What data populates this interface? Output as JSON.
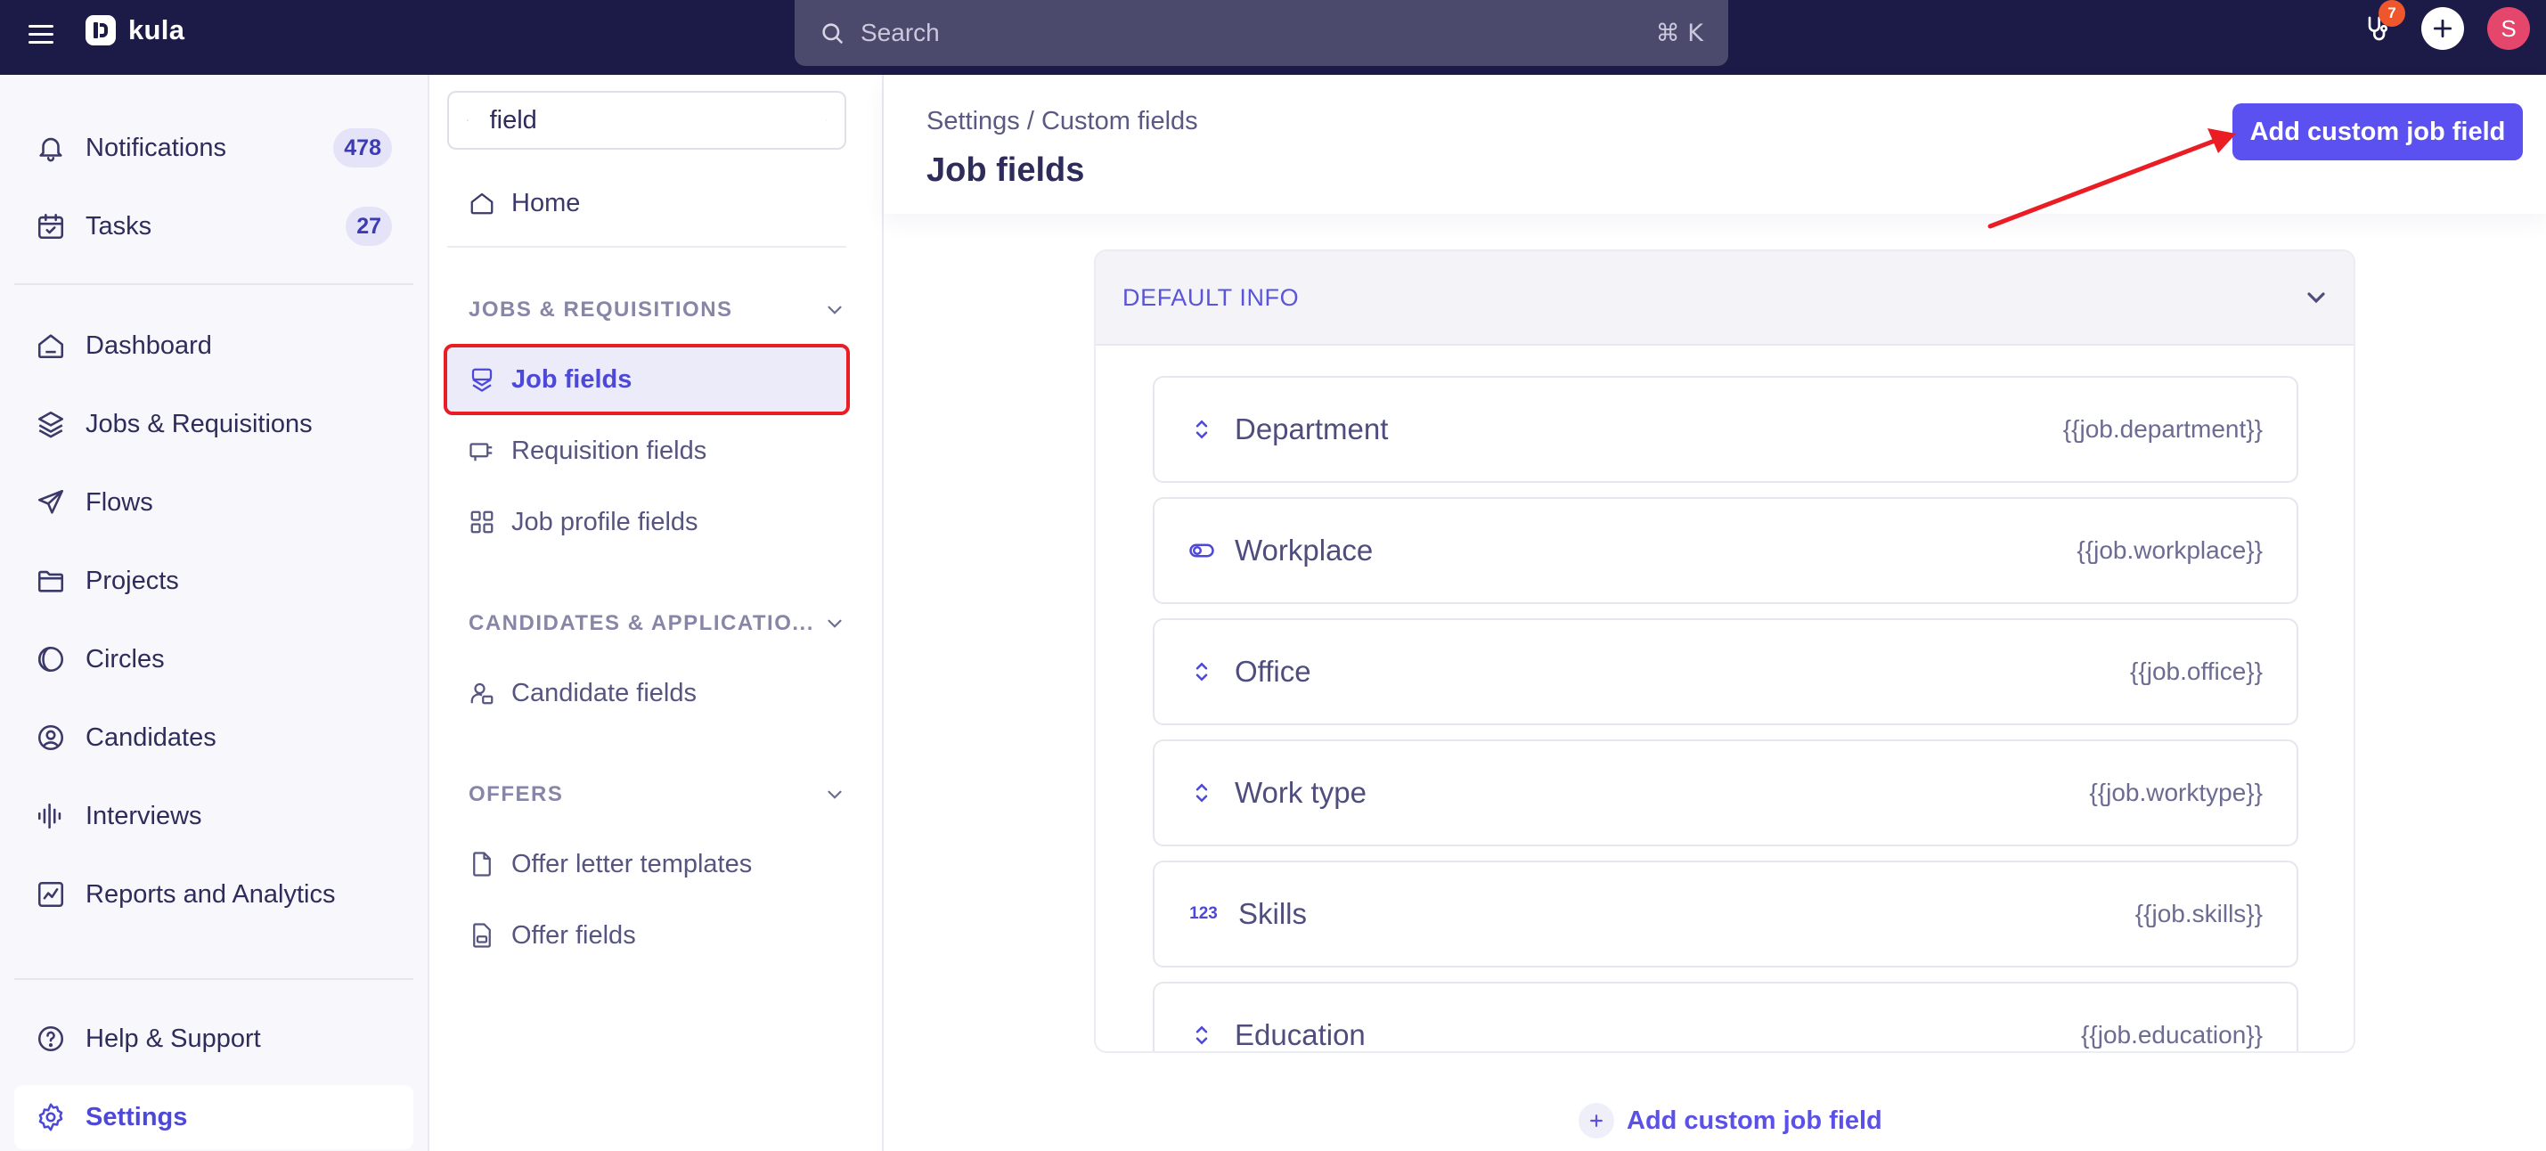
{
  "app": {
    "name": "kula"
  },
  "topbar": {
    "search_placeholder": "Search",
    "shortcut": "⌘ K",
    "notification_badge": "7",
    "avatar_initial": "S"
  },
  "sidebar": {
    "notifications": {
      "label": "Notifications",
      "count": "478"
    },
    "tasks": {
      "label": "Tasks",
      "count": "27"
    },
    "items": [
      {
        "label": "Dashboard",
        "icon": "home-icon"
      },
      {
        "label": "Jobs & Requisitions",
        "icon": "layers-icon"
      },
      {
        "label": "Flows",
        "icon": "send-icon"
      },
      {
        "label": "Projects",
        "icon": "folder-icon"
      },
      {
        "label": "Circles",
        "icon": "circles-icon"
      },
      {
        "label": "Candidates",
        "icon": "user-circle-icon"
      },
      {
        "label": "Interviews",
        "icon": "waveform-icon"
      },
      {
        "label": "Reports and Analytics",
        "icon": "chart-icon"
      }
    ],
    "help": "Help & Support",
    "settings": "Settings"
  },
  "subnav": {
    "search_value": "field",
    "home": "Home",
    "sections": [
      {
        "title": "JOBS & REQUISITIONS",
        "items": [
          "Job fields",
          "Requisition fields",
          "Job profile fields"
        ]
      },
      {
        "title": "CANDIDATES & APPLICATIO...",
        "items": [
          "Candidate fields"
        ]
      },
      {
        "title": "OFFERS",
        "items": [
          "Offer letter templates",
          "Offer fields"
        ]
      }
    ],
    "selected": "Job fields"
  },
  "main": {
    "breadcrumb": {
      "parent": "Settings",
      "separator": "/",
      "current": "Custom fields"
    },
    "title": "Job fields",
    "add_button": "Add custom job field",
    "section_title": "DEFAULT INFO",
    "fields": [
      {
        "name": "Department",
        "variable": "{{job.department}}",
        "icon": "chevrons-updown-icon"
      },
      {
        "name": "Workplace",
        "variable": "{{job.workplace}}",
        "icon": "toggle-icon"
      },
      {
        "name": "Office",
        "variable": "{{job.office}}",
        "icon": "chevrons-updown-icon"
      },
      {
        "name": "Work type",
        "variable": "{{job.worktype}}",
        "icon": "chevrons-updown-icon"
      },
      {
        "name": "Skills",
        "variable": "{{job.skills}}",
        "icon": "number-icon",
        "icon_text": "123"
      },
      {
        "name": "Education",
        "variable": "{{job.education}}",
        "icon": "chevrons-updown-icon"
      }
    ],
    "bottom_add": "Add custom job field"
  },
  "colors": {
    "topbar": "#1c1b47",
    "accent": "#5b51f0",
    "highlight_box": "#ea1c24",
    "badge": "#f0562b",
    "avatar": "#e5466b"
  }
}
